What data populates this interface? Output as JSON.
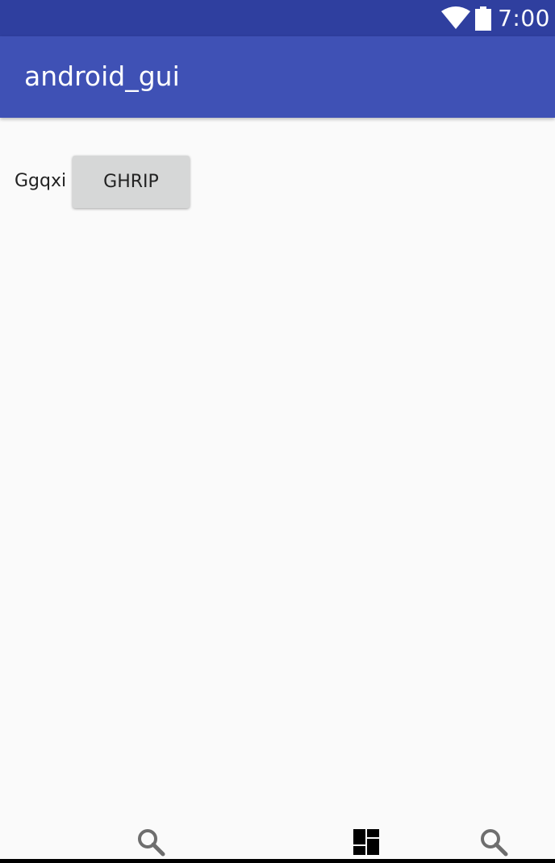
{
  "status_bar": {
    "time": "7:00",
    "icons": [
      "wifi-icon",
      "battery-icon"
    ],
    "background": "#2f3f9f"
  },
  "app_bar": {
    "title": "android_gui",
    "background": "#3f51b5"
  },
  "main": {
    "label": "Ggqxi",
    "button_label": "GHRIP"
  },
  "nav_bar": {
    "icons": [
      "search-icon",
      "dashboard-icon",
      "search-icon"
    ]
  }
}
